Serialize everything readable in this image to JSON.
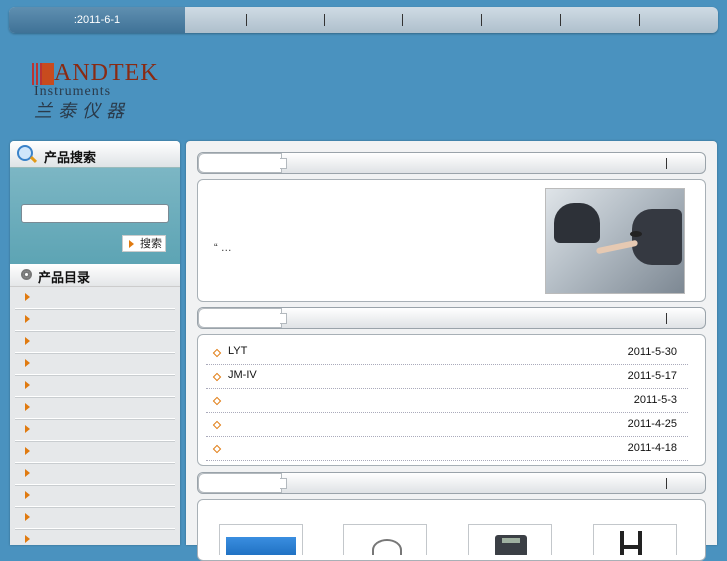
{
  "header": {
    "date": ":2011-6-1",
    "nav_separators": 6
  },
  "logo": {
    "brand": "ANDTEK",
    "subtitle": "Instruments",
    "cn": "兰泰仪器"
  },
  "sidebar": {
    "search_title": "产品搜索",
    "search_button": "搜索",
    "search_value": "",
    "catalog_title": "产品目录",
    "catalog_items": [
      "",
      "",
      "",
      "",
      "",
      "",
      "",
      "",
      "",
      "",
      "",
      ""
    ]
  },
  "intro": {
    "text": "“  …"
  },
  "news": [
    {
      "title": "LYT",
      "date": "2011-5-30"
    },
    {
      "title": "JM-IV",
      "date": "2011-5-17"
    },
    {
      "title": "",
      "date": "2011-5-3"
    },
    {
      "title": "",
      "date": "2011-4-25"
    },
    {
      "title": "",
      "date": "2011-4-18"
    }
  ],
  "colors": {
    "background": "#4a92bf",
    "accent": "#e07a10",
    "brand": "#8a2a12"
  }
}
